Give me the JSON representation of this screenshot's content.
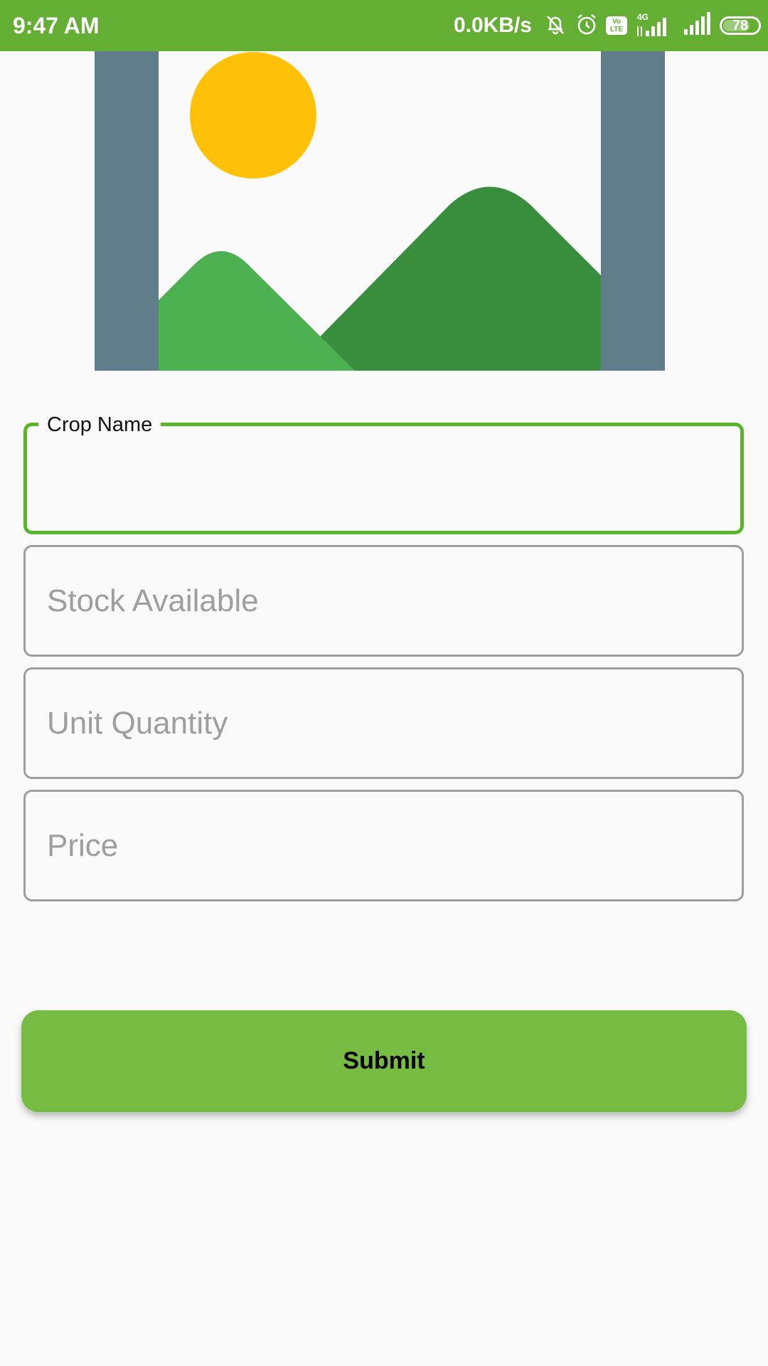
{
  "status_bar": {
    "time": "9:47 AM",
    "network_speed": "0.0KB/s",
    "volte_top": "Vo",
    "volte_bottom": "LTE",
    "network_type": "4G",
    "battery_level": "78",
    "battery_fraction": 0.78
  },
  "image": {
    "icon": "image-placeholder-icon"
  },
  "form": {
    "crop_name": {
      "label": "Crop Name",
      "value": ""
    },
    "stock_available": {
      "placeholder": "Stock Available",
      "value": ""
    },
    "unit_quantity": {
      "placeholder": "Unit Quantity",
      "value": ""
    },
    "price": {
      "placeholder": "Price",
      "value": ""
    }
  },
  "submit_button": {
    "label": "Submit"
  },
  "colors": {
    "status_bar": "#64ae34",
    "focused_border": "#58b42a",
    "button": "#76bb42",
    "placeholder_text": "#9e9e9e",
    "sun": "#ffc107",
    "mountain_dark": "#388e3c",
    "mountain_light": "#4caf50",
    "frame": "#607d8b"
  }
}
